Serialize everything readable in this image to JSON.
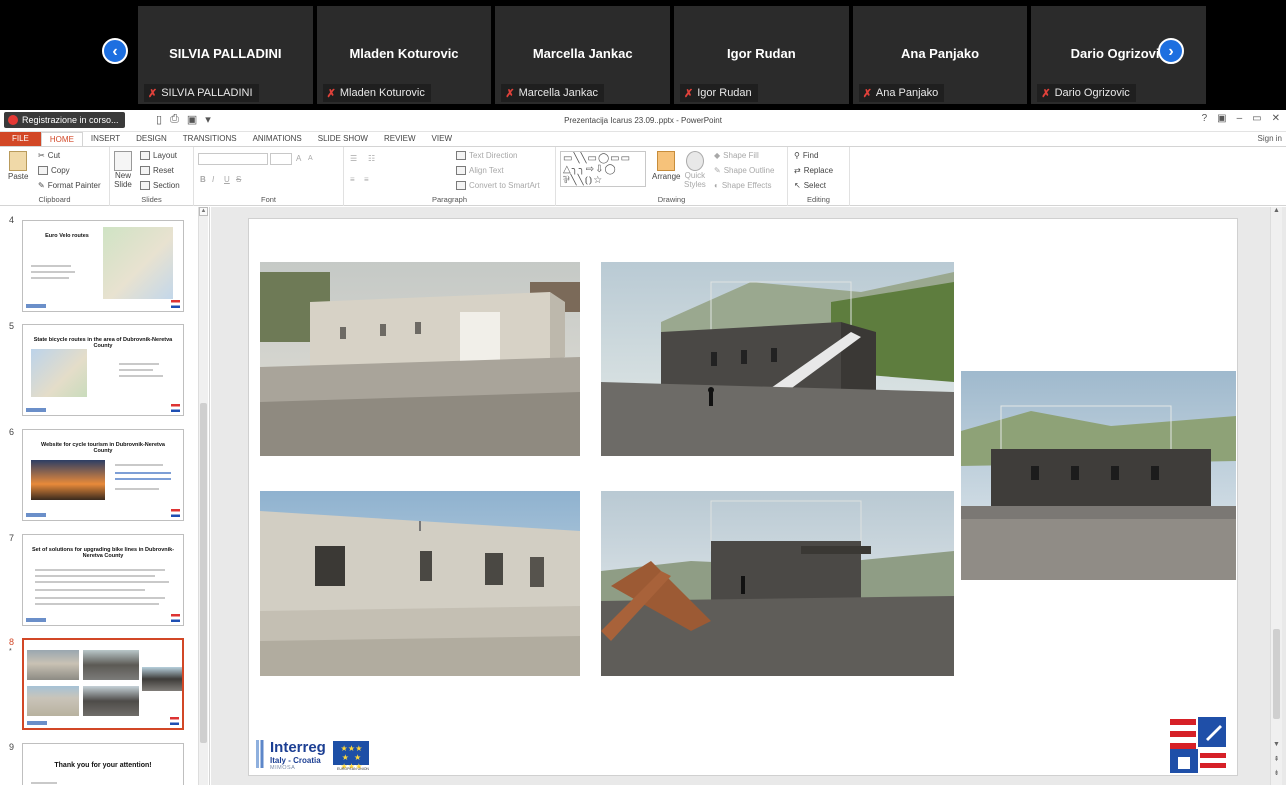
{
  "meeting": {
    "participants": [
      {
        "name": "SILVIA PALLADINI",
        "label": "SILVIA PALLADINI"
      },
      {
        "name": "Mladen Koturovic",
        "label": "Mladen Koturovic"
      },
      {
        "name": "Marcella Jankac",
        "label": "Marcella Jankac"
      },
      {
        "name": "Igor Rudan",
        "label": "Igor Rudan"
      },
      {
        "name": "Ana Panjako",
        "label": "Ana Panjako"
      },
      {
        "name": "Dario Ogrizovic",
        "label": "Dario Ogrizovic"
      }
    ],
    "prev_glyph": "‹",
    "next_glyph": "›",
    "mic_glyph": "🎙"
  },
  "window": {
    "recording_label": "Registrazione in corso...",
    "title": "Prezentacija Icarus 23.09..pptx - PowerPoint",
    "controls": [
      "?",
      "▣",
      "–",
      "▭",
      "✕"
    ],
    "sign_in": "Sign in"
  },
  "ribbon": {
    "tabs": [
      "FILE",
      "HOME",
      "INSERT",
      "DESIGN",
      "TRANSITIONS",
      "ANIMATIONS",
      "SLIDE SHOW",
      "REVIEW",
      "VIEW"
    ],
    "active_tab": "HOME",
    "clipboard": {
      "paste": "Paste",
      "cut": "Cut",
      "copy": "Copy",
      "format_painter": "Format Painter",
      "label": "Clipboard"
    },
    "slides": {
      "new_slide": "New",
      "new_slide_2": "Slide",
      "layout": "Layout",
      "reset": "Reset",
      "section": "Section",
      "label": "Slides"
    },
    "font": {
      "bold": "B",
      "italic": "I",
      "underline": "U",
      "strike": "S",
      "grow": "A",
      "shrink": "A",
      "label": "Font"
    },
    "paragraph": {
      "text_direction": "Text Direction",
      "align_text": "Align Text",
      "convert_smartart": "Convert to SmartArt",
      "label": "Paragraph"
    },
    "drawing": {
      "arrange": "Arrange",
      "quick_styles": "Quick",
      "quick_styles_2": "Styles",
      "shape_fill": "Shape Fill",
      "shape_outline": "Shape Outline",
      "shape_effects": "Shape Effects",
      "label": "Drawing"
    },
    "editing": {
      "find": "Find",
      "replace": "Replace",
      "select": "Select",
      "label": "Editing"
    }
  },
  "thumbnails": [
    {
      "num": "4",
      "title": "Euro Velo routes"
    },
    {
      "num": "5",
      "title": "State bicycle routes in the area of Dubrovnik-Neretva County"
    },
    {
      "num": "6",
      "title": "Website for cycle tourism in Dubrovnik-Neretva County"
    },
    {
      "num": "7",
      "title": "Set of solutions for upgrading bike lines in Dubrovnik-Neretva County"
    },
    {
      "num": "8",
      "title": ""
    },
    {
      "num": "9",
      "title": "Thank you for your attention!"
    }
  ],
  "selected_slide": "8",
  "slide": {
    "logo_word": "Interreg",
    "logo_sub": "Italy - Croatia",
    "logo_project": "MIMOSA",
    "eu_caption": "EUROPEAN UNION",
    "eu_stars": "★ ★ ★\n★     ★\n★ ★ ★"
  },
  "colors": {
    "accent": "#d24726",
    "teams_blue": "#1d6fe0",
    "interreg_blue": "#1c3f93"
  }
}
